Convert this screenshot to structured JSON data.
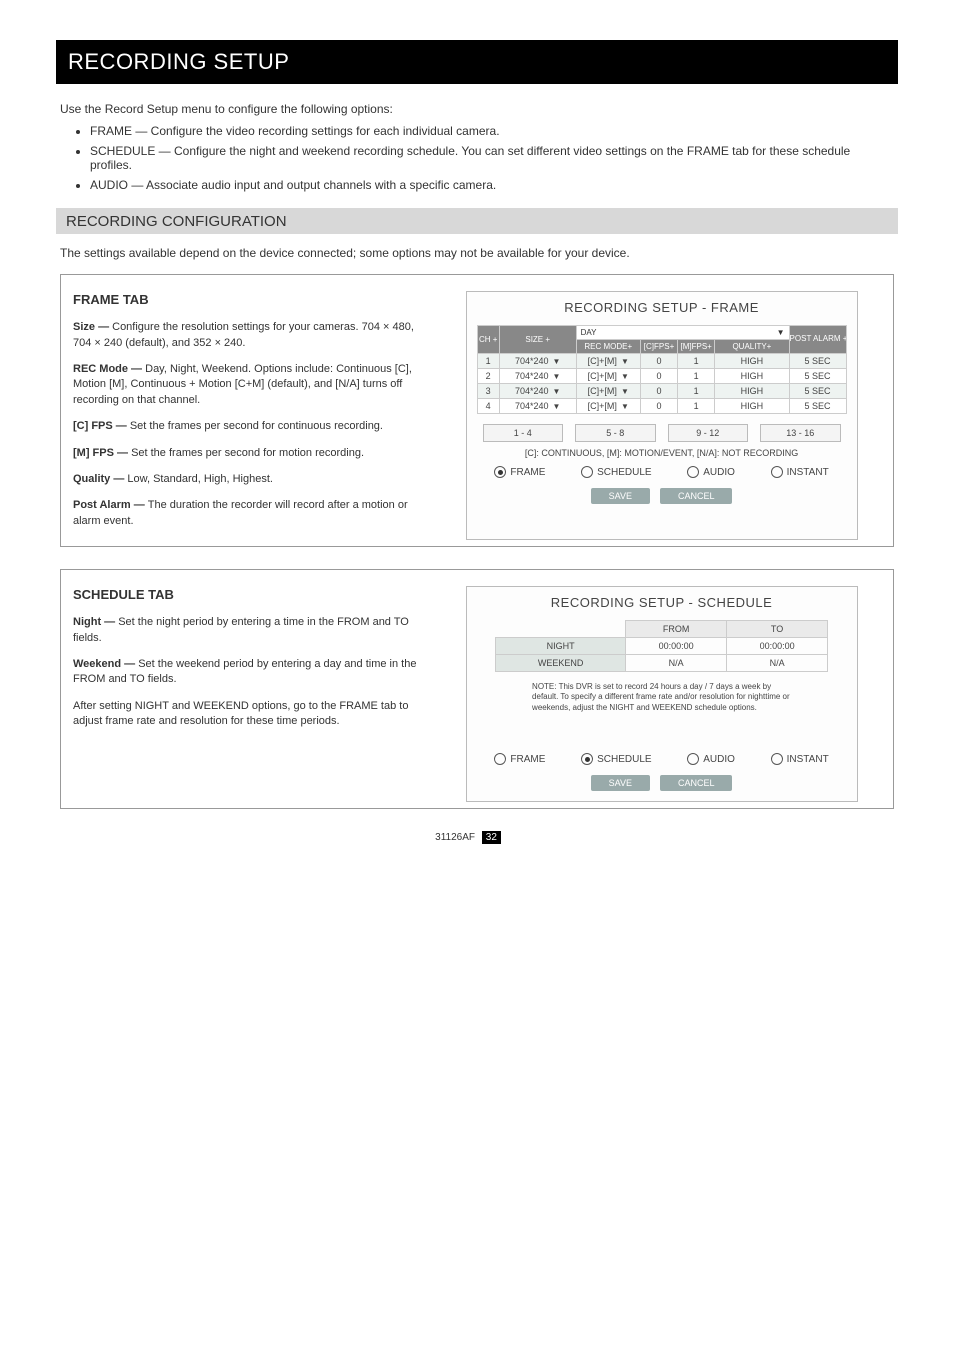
{
  "header_title": "RECORDING SETUP",
  "intro": "Use the Record Setup menu to configure the following options:",
  "bullets": [
    "FRAME — Configure the video recording settings for each individual camera.",
    "SCHEDULE — Configure the night and weekend recording schedule. You can set different video settings on the FRAME tab for these schedule profiles.",
    "AUDIO — Associate audio input and output channels with a specific camera."
  ],
  "gray_title": "RECORDING CONFIGURATION",
  "gray_desc": "The settings available depend on the device connected; some options may not be available for your device.",
  "frame_tab": {
    "name": "FRAME TAB",
    "p1a": "Size — ",
    "p1b": "Configure the resolution settings for your cameras. 704 × 480, 704 × 240 (default), and 352 × 240.",
    "p2a": "REC Mode — ",
    "p2b": "Day, Night, Weekend. Options include: Continuous [C], Motion [M], Continuous + Motion [C+M] (default), and [N/A] turns off recording on that channel.",
    "p3a": "[C] FPS — ",
    "p3b": "Set the frames per second for continuous recording.",
    "p4a": "[M] FPS — ",
    "p4b": "Set the frames per second for motion recording.",
    "p5a": "Quality — ",
    "p5b": "Low, Standard, High, Highest.",
    "p6a": "Post Alarm — ",
    "p6b": "The duration the recorder will record after a motion or alarm event."
  },
  "panel_frame": {
    "title": "RECORDING SETUP - FRAME",
    "day_label": "DAY",
    "hdr_ch": "CH +",
    "hdr_size": "SIZE +",
    "hdr_mode": "REC MODE+",
    "hdr_cfps": "[C]FPS+",
    "hdr_mfps": "[M]FPS+",
    "hdr_qual": "QUALITY+",
    "hdr_post": "POST ALARM +",
    "rows": [
      {
        "ch": "1",
        "size": "704*240",
        "mode": "[C]+[M]",
        "cfps": "0",
        "mfps": "1",
        "qual": "HIGH",
        "post": "5 SEC"
      },
      {
        "ch": "2",
        "size": "704*240",
        "mode": "[C]+[M]",
        "cfps": "0",
        "mfps": "1",
        "qual": "HIGH",
        "post": "5 SEC"
      },
      {
        "ch": "3",
        "size": "704*240",
        "mode": "[C]+[M]",
        "cfps": "0",
        "mfps": "1",
        "qual": "HIGH",
        "post": "5 SEC"
      },
      {
        "ch": "4",
        "size": "704*240",
        "mode": "[C]+[M]",
        "cfps": "0",
        "mfps": "1",
        "qual": "HIGH",
        "post": "5 SEC"
      }
    ],
    "pager": [
      "1 - 4",
      "5 - 8",
      "9 - 12",
      "13 - 16"
    ],
    "legend": "[C]: CONTINUOUS, [M]: MOTION/EVENT, [N/A]: NOT RECORDING",
    "radios": [
      "FRAME",
      "SCHEDULE",
      "AUDIO",
      "INSTANT"
    ],
    "save": "SAVE",
    "cancel": "CANCEL"
  },
  "sched_tab": {
    "name": "SCHEDULE TAB",
    "p1a": "Night — ",
    "p1b": "Set the night period by entering a time in the FROM and TO fields.",
    "p2a": "Weekend — ",
    "p2b": "Set the weekend period by entering a day and time in the FROM and TO fields.",
    "p3": "After setting NIGHT and WEEKEND options, go to the FRAME tab to adjust frame rate and resolution for these time periods."
  },
  "panel_sched": {
    "title": "RECORDING SETUP - SCHEDULE",
    "hdr_from": "FROM",
    "hdr_to": "TO",
    "row1": {
      "label": "NIGHT",
      "from": "00:00:00",
      "to": "00:00:00"
    },
    "row2": {
      "label": "WEEKEND",
      "from": "N/A",
      "to": "N/A"
    },
    "note": "NOTE:  This DVR is set to record 24 hours a day / 7 days a week by default. To specify a different frame rate and/or resolution for nighttime or weekends, adjust the NIGHT and WEEKEND schedule options.",
    "radios": [
      "FRAME",
      "SCHEDULE",
      "AUDIO",
      "INSTANT"
    ],
    "save": "SAVE",
    "cancel": "CANCEL"
  },
  "footer": {
    "left": "31126AF",
    "num": "32",
    "right": "32"
  }
}
